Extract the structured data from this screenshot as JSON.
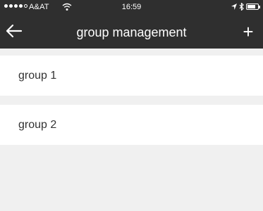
{
  "status_bar": {
    "carrier": "A&AT",
    "time": "16:59",
    "signal_strength": 4,
    "signal_max": 5,
    "battery_level": 0.8
  },
  "nav_bar": {
    "title": "group management",
    "back_icon": "arrow-left-icon",
    "add_label": "+"
  },
  "groups": [
    {
      "label": "group 1"
    },
    {
      "label": "group 2"
    }
  ],
  "colors": {
    "header_background": "#2f2f2f",
    "page_background": "#f0f0f0",
    "list_item_background": "#ffffff",
    "text": "#333333"
  }
}
